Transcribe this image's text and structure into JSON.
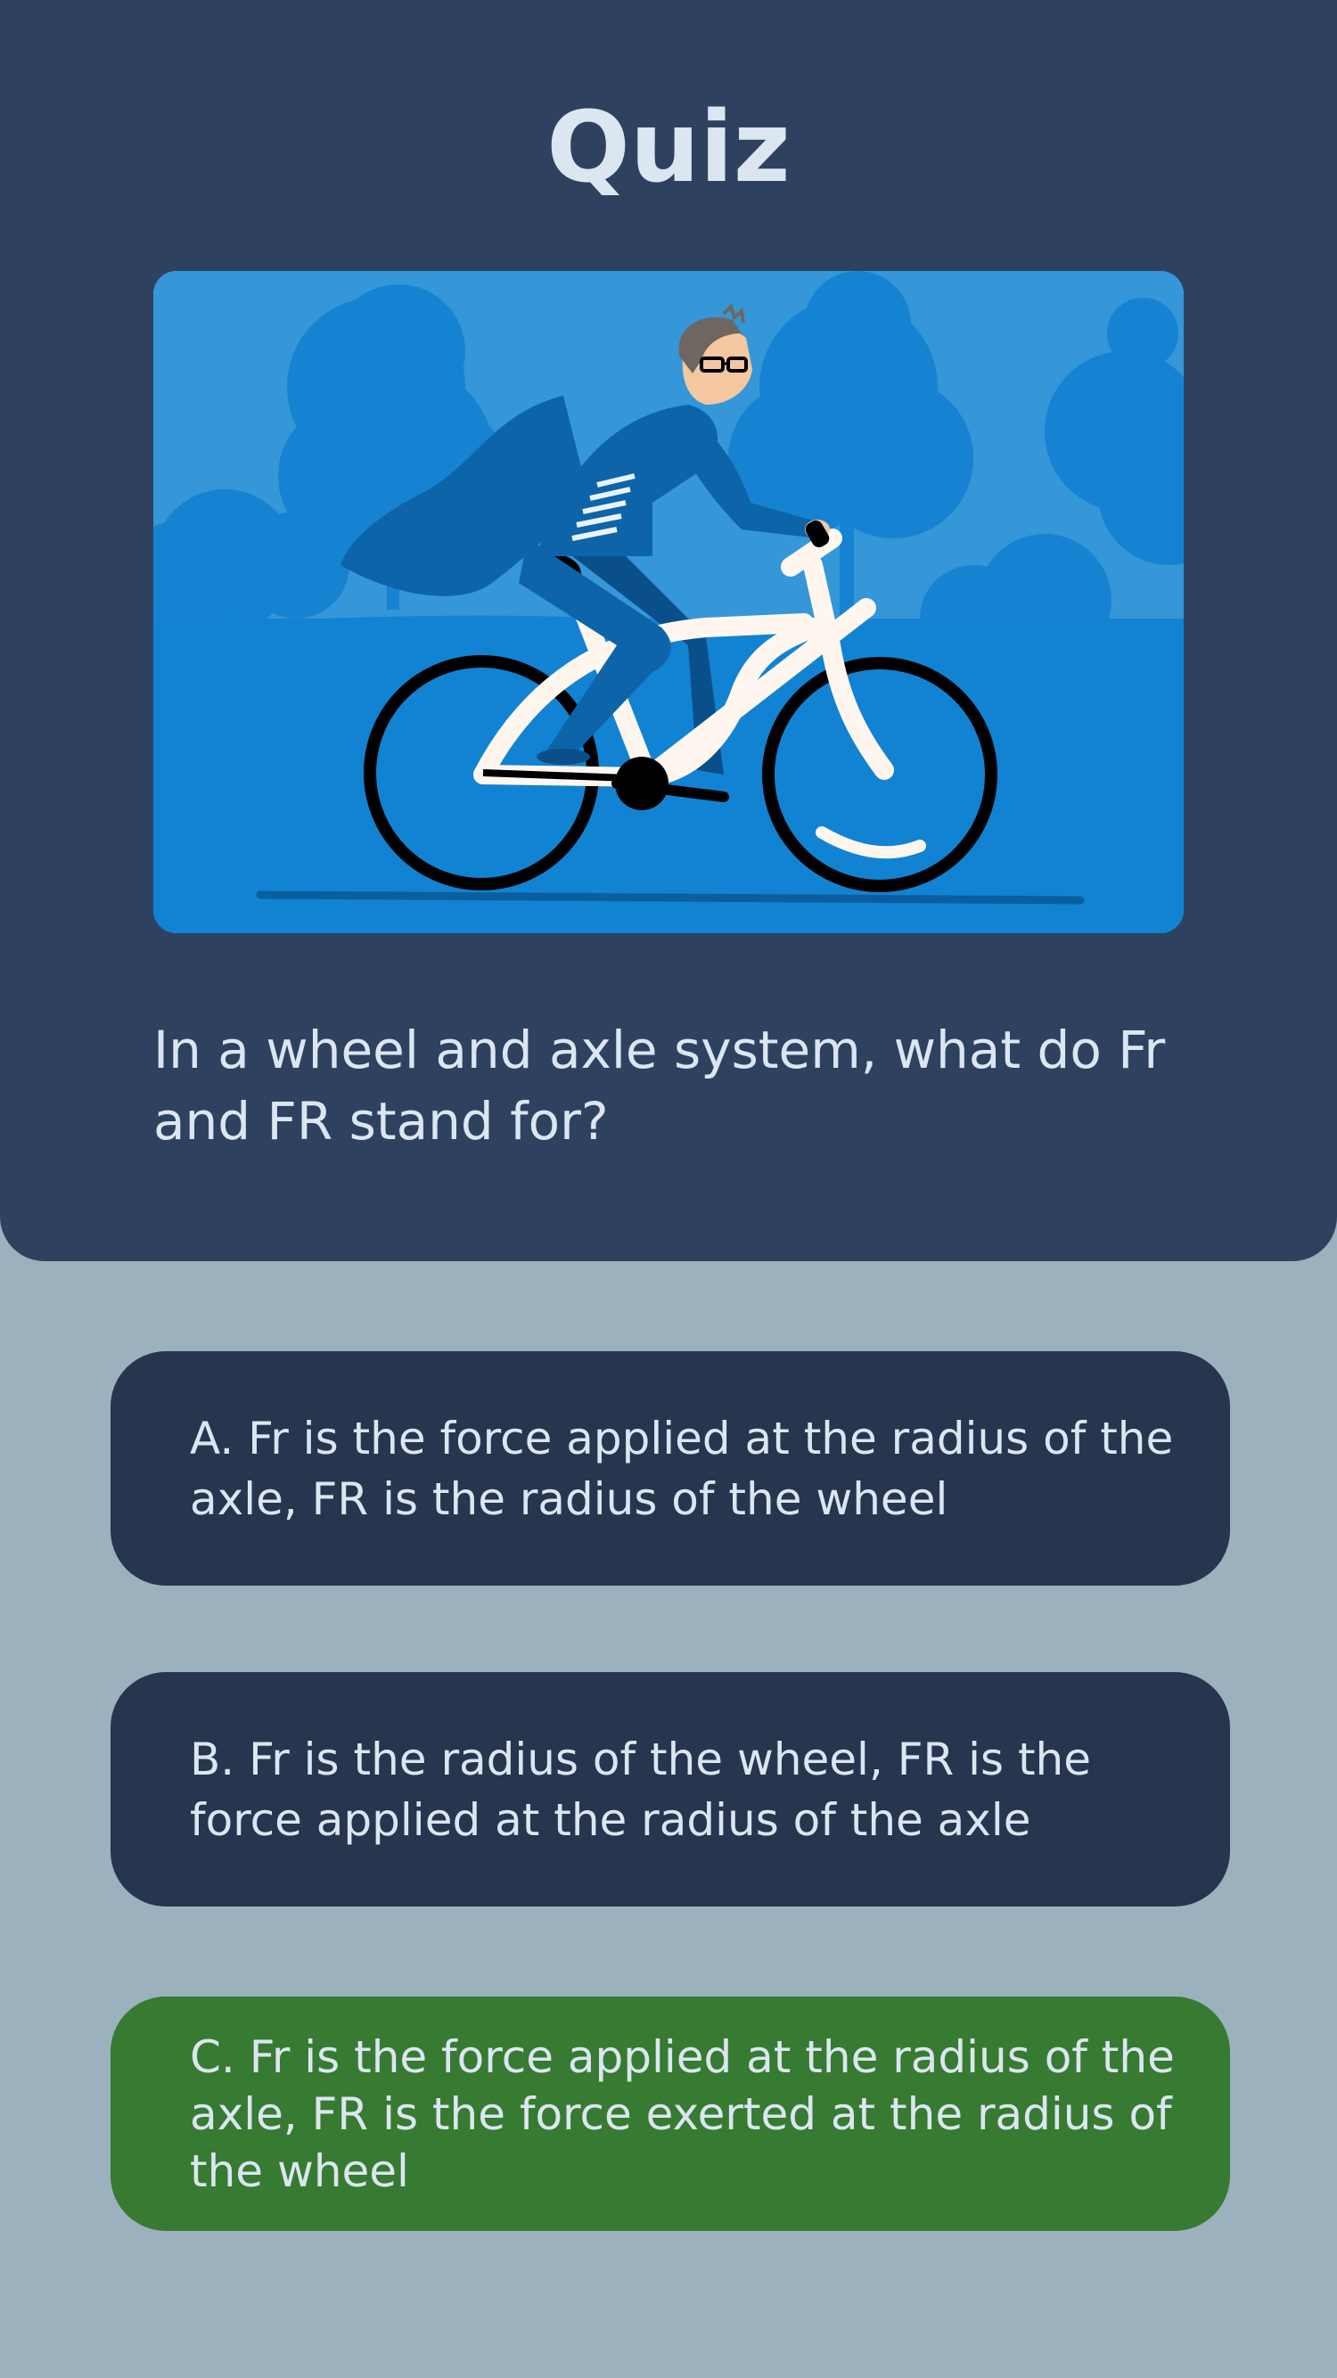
{
  "quiz": {
    "title": "Quiz",
    "question": "In a wheel and axle system, what do Fr and FR stand for?",
    "illustration_icon": "cyclist-illustration",
    "options": [
      {
        "label": "A. Fr is the force applied at the radius of the axle, FR is the radius of the wheel",
        "state": "default"
      },
      {
        "label": "B. Fr is the radius of the wheel, FR is the force applied at the radius  of the axle",
        "state": "default"
      },
      {
        "label": "C. Fr is the force applied at the radius of the axle, FR is the force exerted at the radius of the wheel",
        "state": "correct"
      }
    ]
  },
  "colors": {
    "background": "#9cb1be",
    "header_panel": "#2e4260",
    "option_default": "#27354e",
    "option_correct": "#377a31",
    "text": "#dbe6f1",
    "illustration_sky": "#3596d8"
  }
}
